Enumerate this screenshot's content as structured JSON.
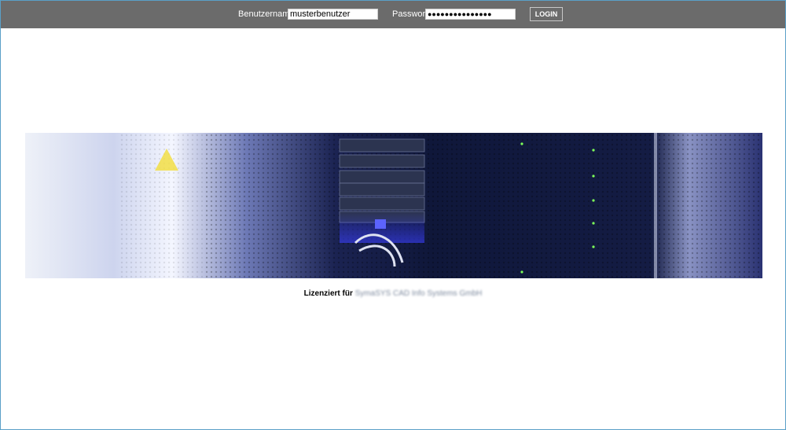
{
  "login": {
    "username_label": "Benutzername",
    "username_value": "musterbenutzer",
    "password_label": "Passwort",
    "password_value": "●●●●●●●●●●●●●●●",
    "button_label": "LOGIN"
  },
  "footer": {
    "license_prefix": "Lizenziert für",
    "license_holder": "SymaSYS CAD Info Systems GmbH"
  },
  "colors": {
    "topbar": "#6b6b6b",
    "frame_border": "#5aa0c8"
  },
  "banner": {
    "icon": "server-rack-image"
  }
}
